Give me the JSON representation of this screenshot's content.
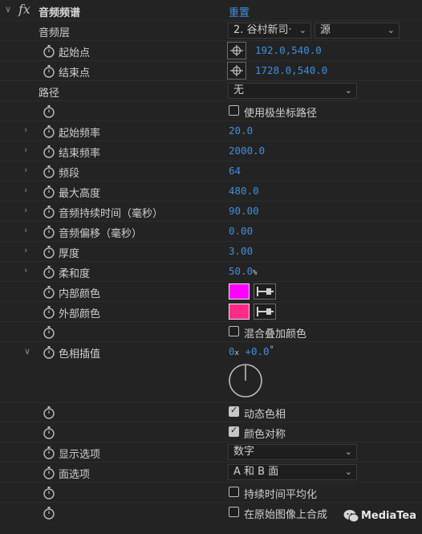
{
  "effect": {
    "fx": "fx",
    "name": "音频频谱",
    "reset": "重置"
  },
  "audio_layer": {
    "label": "音频层",
    "layer": "2. 谷村新司·",
    "source": "源"
  },
  "start_point": {
    "label": "起始点",
    "x": "192.0",
    "y": "540.0"
  },
  "end_point": {
    "label": "结束点",
    "x": "1728.0",
    "y": "540.0"
  },
  "path": {
    "label": "路径",
    "value": "无"
  },
  "polar": {
    "label": "使用极坐标路径",
    "checked": false
  },
  "start_freq": {
    "label": "起始频率",
    "value": "20.0"
  },
  "end_freq": {
    "label": "结束频率",
    "value": "2000.0"
  },
  "bands": {
    "label": "频段",
    "value": "64"
  },
  "max_height": {
    "label": "最大高度",
    "value": "480.0"
  },
  "duration": {
    "label": "音频持续时间（毫秒）",
    "value": "90.00"
  },
  "offset": {
    "label": "音频偏移（毫秒）",
    "value": "0.00"
  },
  "thickness": {
    "label": "厚度",
    "value": "3.00"
  },
  "softness": {
    "label": "柔和度",
    "value": "50.0",
    "unit": "%"
  },
  "inside_color": {
    "label": "内部颜色",
    "color": "#ff00ff"
  },
  "outside_color": {
    "label": "外部颜色",
    "color": "#ff2a8a"
  },
  "blend_overlap": {
    "label": "混合叠加颜色",
    "checked": false
  },
  "hue_interp": {
    "label": "色相插值",
    "revs": "0",
    "x": "x",
    "deg": "+0.0",
    "degsym": "°"
  },
  "dynamic_hue": {
    "label": "动态色相",
    "checked": true
  },
  "color_symmetry": {
    "label": "颜色对称",
    "checked": true
  },
  "display_options": {
    "label": "显示选项",
    "value": "数字"
  },
  "side_options": {
    "label": "面选项",
    "value": "A 和 B 面"
  },
  "duration_avg": {
    "label": "持续时间平均化",
    "checked": false
  },
  "composite": {
    "label": "在原始图像上合成",
    "checked": false
  },
  "watermark": {
    "text": "MediaTea"
  },
  "colors": {
    "accent": "#3f8fde",
    "background": "#232323"
  }
}
